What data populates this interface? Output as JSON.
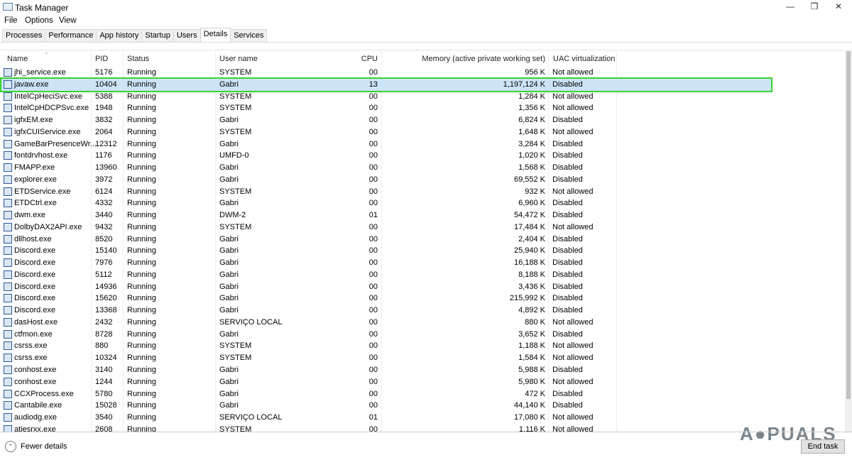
{
  "window": {
    "title": "Task Manager"
  },
  "menu": [
    "File",
    "Options",
    "View"
  ],
  "tabs": [
    {
      "label": "Processes"
    },
    {
      "label": "Performance"
    },
    {
      "label": "App history"
    },
    {
      "label": "Startup"
    },
    {
      "label": "Users"
    },
    {
      "label": "Details",
      "active": true
    },
    {
      "label": "Services"
    }
  ],
  "columns": {
    "name": "Name",
    "pid": "PID",
    "status": "Status",
    "user": "User name",
    "cpu": "CPU",
    "memory": "Memory (active private working set)",
    "uac": "UAC virtualization"
  },
  "rows": [
    [
      "jhi_service.exe",
      "5176",
      "Running",
      "SYSTEM",
      "00",
      "956 K",
      "Not allowed"
    ],
    [
      "javaw.exe",
      "10404",
      "Running",
      "Gabri",
      "13",
      "1,197,124 K",
      "Disabled"
    ],
    [
      "IntelCpHeciSvc.exe",
      "5388",
      "Running",
      "SYSTEM",
      "00",
      "1,284 K",
      "Not allowed"
    ],
    [
      "IntelCpHDCPSvc.exe",
      "1948",
      "Running",
      "SYSTEM",
      "00",
      "1,356 K",
      "Not allowed"
    ],
    [
      "igfxEM.exe",
      "3832",
      "Running",
      "Gabri",
      "00",
      "6,824 K",
      "Disabled"
    ],
    [
      "igfxCUIService.exe",
      "2064",
      "Running",
      "SYSTEM",
      "00",
      "1,648 K",
      "Not allowed"
    ],
    [
      "GameBarPresenceWr...",
      "12312",
      "Running",
      "Gabri",
      "00",
      "3,284 K",
      "Disabled"
    ],
    [
      "fontdrvhost.exe",
      "1176",
      "Running",
      "UMFD-0",
      "00",
      "1,020 K",
      "Disabled"
    ],
    [
      "FMAPP.exe",
      "13960",
      "Running",
      "Gabri",
      "00",
      "1,568 K",
      "Disabled"
    ],
    [
      "explorer.exe",
      "3972",
      "Running",
      "Gabri",
      "00",
      "69,552 K",
      "Disabled"
    ],
    [
      "ETDService.exe",
      "6124",
      "Running",
      "SYSTEM",
      "00",
      "932 K",
      "Not allowed"
    ],
    [
      "ETDCtrl.exe",
      "4332",
      "Running",
      "Gabri",
      "00",
      "6,960 K",
      "Disabled"
    ],
    [
      "dwm.exe",
      "3440",
      "Running",
      "DWM-2",
      "01",
      "54,472 K",
      "Disabled"
    ],
    [
      "DolbyDAX2API.exe",
      "9432",
      "Running",
      "SYSTEM",
      "00",
      "17,484 K",
      "Not allowed"
    ],
    [
      "dllhost.exe",
      "8520",
      "Running",
      "Gabri",
      "00",
      "2,404 K",
      "Disabled"
    ],
    [
      "Discord.exe",
      "15140",
      "Running",
      "Gabri",
      "00",
      "25,940 K",
      "Disabled"
    ],
    [
      "Discord.exe",
      "7976",
      "Running",
      "Gabri",
      "00",
      "16,188 K",
      "Disabled"
    ],
    [
      "Discord.exe",
      "5112",
      "Running",
      "Gabri",
      "00",
      "8,188 K",
      "Disabled"
    ],
    [
      "Discord.exe",
      "14936",
      "Running",
      "Gabri",
      "00",
      "3,436 K",
      "Disabled"
    ],
    [
      "Discord.exe",
      "15620",
      "Running",
      "Gabri",
      "00",
      "215,992 K",
      "Disabled"
    ],
    [
      "Discord.exe",
      "13368",
      "Running",
      "Gabri",
      "00",
      "4,892 K",
      "Disabled"
    ],
    [
      "dasHost.exe",
      "2432",
      "Running",
      "SERVIÇO LOCAL",
      "00",
      "880 K",
      "Not allowed"
    ],
    [
      "ctfmon.exe",
      "8728",
      "Running",
      "Gabri",
      "00",
      "3,652 K",
      "Disabled"
    ],
    [
      "csrss.exe",
      "880",
      "Running",
      "SYSTEM",
      "00",
      "1,188 K",
      "Not allowed"
    ],
    [
      "csrss.exe",
      "10324",
      "Running",
      "SYSTEM",
      "00",
      "1,584 K",
      "Not allowed"
    ],
    [
      "conhost.exe",
      "3140",
      "Running",
      "Gabri",
      "00",
      "5,988 K",
      "Disabled"
    ],
    [
      "conhost.exe",
      "1244",
      "Running",
      "Gabri",
      "00",
      "5,980 K",
      "Not allowed"
    ],
    [
      "CCXProcess.exe",
      "5780",
      "Running",
      "Gabri",
      "00",
      "472 K",
      "Disabled"
    ],
    [
      "Cantabile.exe",
      "15028",
      "Running",
      "Gabri",
      "00",
      "44,140 K",
      "Disabled"
    ],
    [
      "audiodg.exe",
      "3540",
      "Running",
      "SERVIÇO LOCAL",
      "01",
      "17,080 K",
      "Not allowed"
    ],
    [
      "atiesrxx.exe",
      "2608",
      "Running",
      "SYSTEM",
      "00",
      "1,116 K",
      "Not allowed"
    ]
  ],
  "selected_row": 1,
  "footer": {
    "fewer_details": "Fewer details",
    "end_task": "End task"
  },
  "watermark": "APPUALS"
}
